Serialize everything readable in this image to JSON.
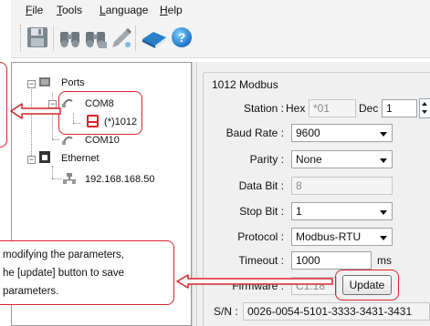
{
  "menu": {
    "items": [
      {
        "id": "file",
        "first": "F",
        "rest": "ile"
      },
      {
        "id": "tools",
        "first": "T",
        "rest": "ools"
      },
      {
        "id": "language",
        "first": "L",
        "rest": "anguage"
      },
      {
        "id": "help",
        "first": "H",
        "rest": "elp"
      }
    ]
  },
  "toolbar": {
    "icons": [
      "save-icon",
      "search-device-icon",
      "search-network-icon",
      "edit-settings-icon",
      "manual-book-icon",
      "help-icon"
    ]
  },
  "tree": {
    "ports_label": "Ports",
    "com8_label": "COM8",
    "device_label": "(*)1012",
    "com10_label": "COM10",
    "ethernet_label": "Ethernet",
    "ip_label": "192.168.168.50"
  },
  "settings": {
    "group_title": "1012 Modbus",
    "station_label": "Station :",
    "hex_label": "Hex",
    "hex_value": "*01",
    "dec_label": "Dec",
    "dec_value": "1",
    "baud_label": "Baud Rate :",
    "baud_value": "9600",
    "parity_label": "Parity :",
    "parity_value": "None",
    "databit_label": "Data Bit :",
    "databit_value": "8",
    "stopbit_label": "Stop Bit :",
    "stopbit_value": "1",
    "protocol_label": "Protocol :",
    "protocol_value": "Modbus-RTU",
    "timeout_label": "Timeout :",
    "timeout_value": "1000",
    "timeout_unit": "ms",
    "firmware_label": "Firmware :",
    "firmware_value": "C1.18",
    "update_button": "Update",
    "sn_label": "S/N :",
    "sn_value": "0026-0054-5101-3333-3431-3431"
  },
  "callout": {
    "line1": "modifying the parameters,",
    "line2": "he [update] button to save",
    "line3": "parameters."
  },
  "colors": {
    "callout_red": "#d9232a",
    "window_bg": "#f0f0f0"
  }
}
